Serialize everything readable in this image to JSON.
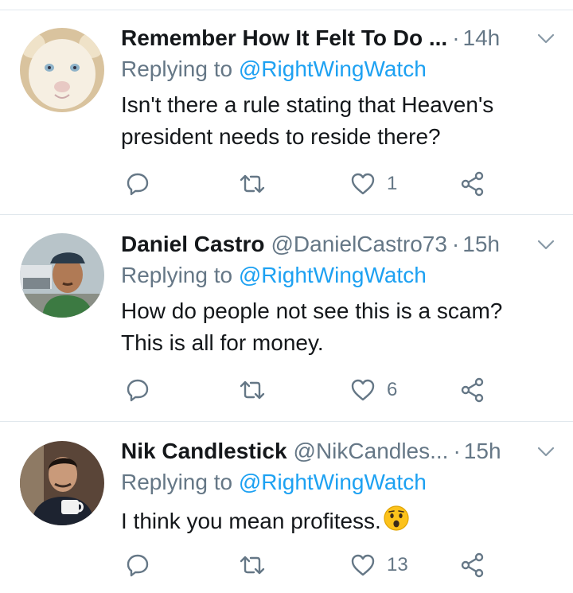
{
  "tweets": [
    {
      "name": "Remember How It Felt To Do ...",
      "handle": "",
      "time": "14h",
      "replying_prefix": "Replying to ",
      "replying_to": "@RightWingWatch",
      "lines": [
        "Isn't there a rule stating that Heaven's",
        "president needs to reside there?"
      ],
      "likes": "1",
      "avatar": "white-lion-cub"
    },
    {
      "name": "Daniel Castro",
      "handle": "@DanielCastro73",
      "time": "15h",
      "replying_prefix": "Replying to ",
      "replying_to": "@RightWingWatch",
      "lines": [
        "How do people not see this is a scam?",
        "This is all for money."
      ],
      "likes": "6",
      "avatar": "man-in-cap"
    },
    {
      "name": "Nik Candlestick",
      "handle": "@NikCandles...",
      "time": "15h",
      "replying_prefix": "Replying to ",
      "replying_to": "@RightWingWatch",
      "lines": [
        "I think you mean profitess."
      ],
      "likes": "13",
      "avatar": "man-with-mug",
      "emoji": "astonished-face"
    }
  ],
  "colors": {
    "text": "#14171a",
    "secondary": "#657786",
    "link": "#1da1f2",
    "divider": "#e1e8ed"
  },
  "icons": [
    "reply-icon",
    "retweet-icon",
    "like-icon",
    "share-icon",
    "chevron-down-icon"
  ]
}
